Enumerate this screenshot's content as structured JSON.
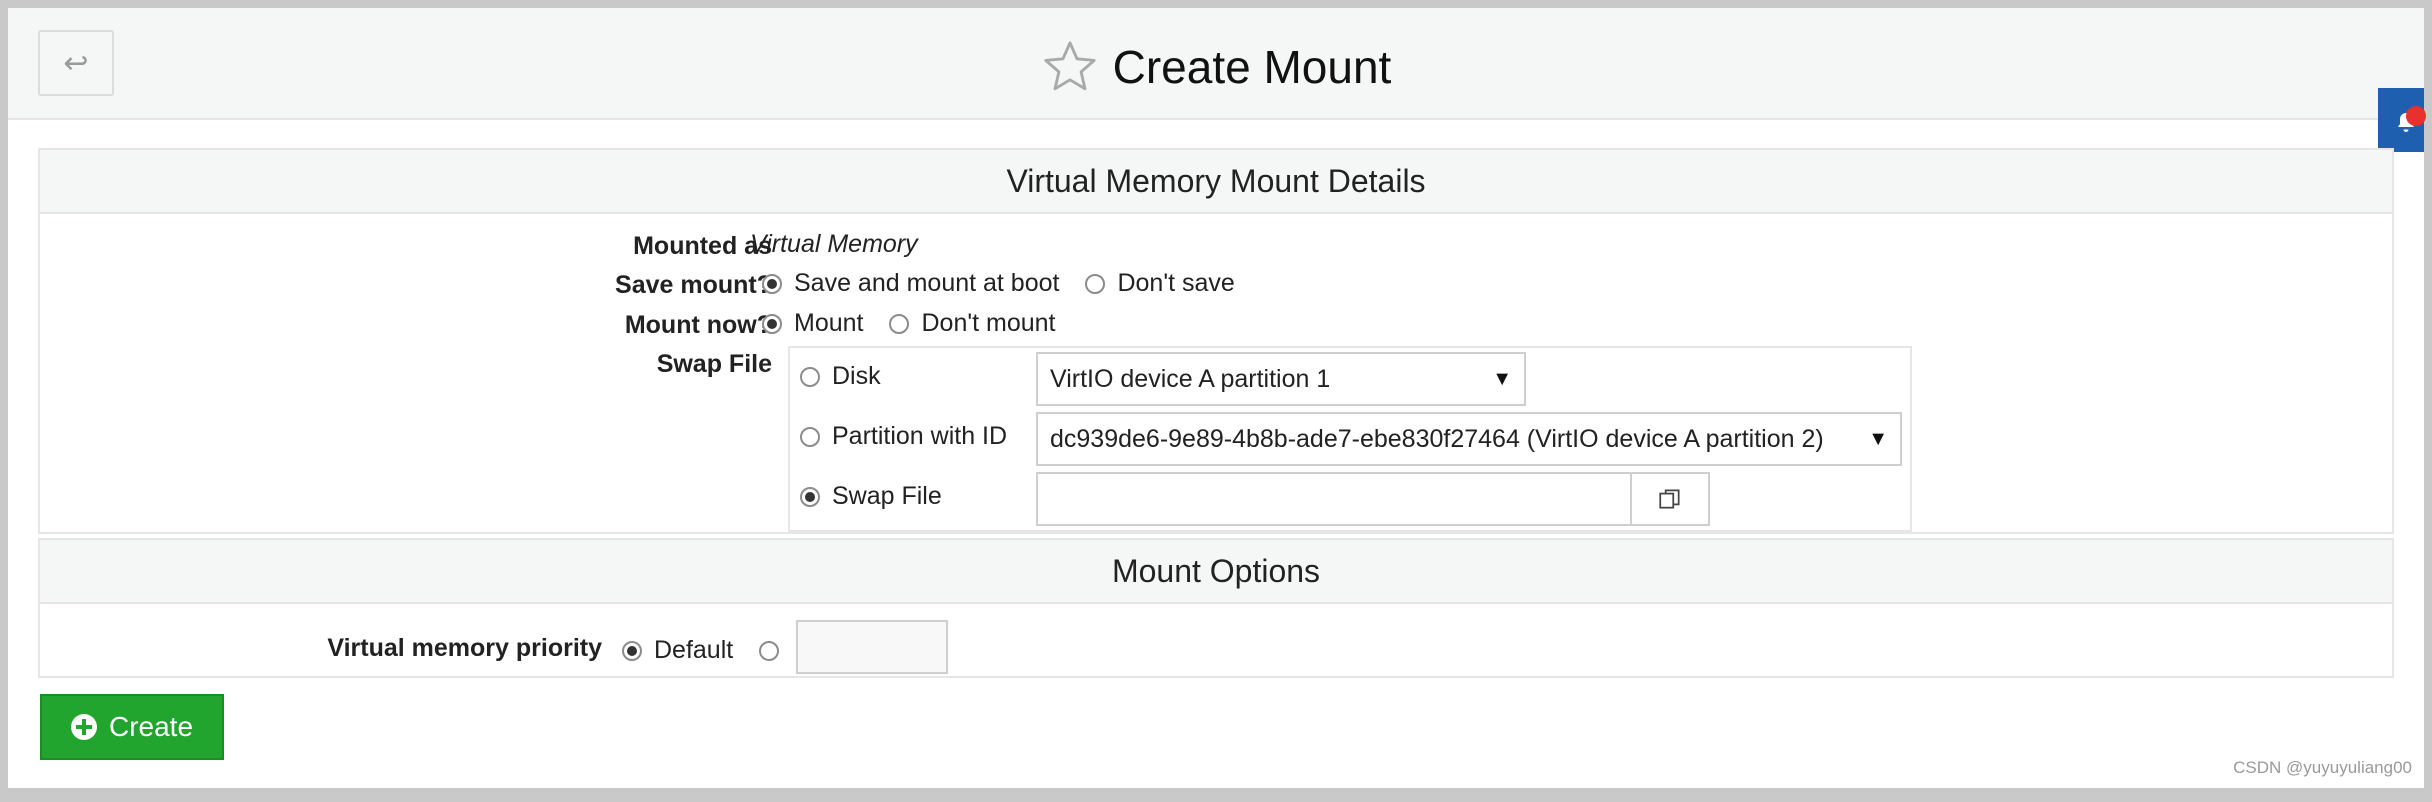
{
  "header": {
    "title": "Create Mount",
    "back_icon": "back-arrow-icon",
    "star_icon": "star-outline-icon"
  },
  "details": {
    "heading": "Virtual Memory Mount Details",
    "mounted_as_label": "Mounted as",
    "mounted_as_value": "Virtual Memory",
    "save_mount_label": "Save mount?",
    "save_mount_options": [
      "Save and mount at boot",
      "Don't save"
    ],
    "mount_now_label": "Mount now?",
    "mount_now_options": [
      "Mount",
      "Don't mount"
    ],
    "swap_file_label": "Swap File",
    "swap": {
      "disk_label": "Disk",
      "disk_value": "VirtIO device A partition 1",
      "partition_label": "Partition with ID",
      "partition_value": "dc939de6-9e89-4b8b-ade7-ebe830f27464 (VirtIO device A partition 2)",
      "file_label": "Swap File",
      "file_value": ""
    }
  },
  "options": {
    "heading": "Mount Options",
    "priority_label": "Virtual memory priority",
    "priority_default": "Default",
    "priority_value": ""
  },
  "create_button": "Create",
  "watermark": "CSDN @yuyuyuliang00",
  "colors": {
    "create_green": "#22a52f",
    "notify_blue": "#1f5fb0",
    "notify_red": "#e8302c"
  }
}
